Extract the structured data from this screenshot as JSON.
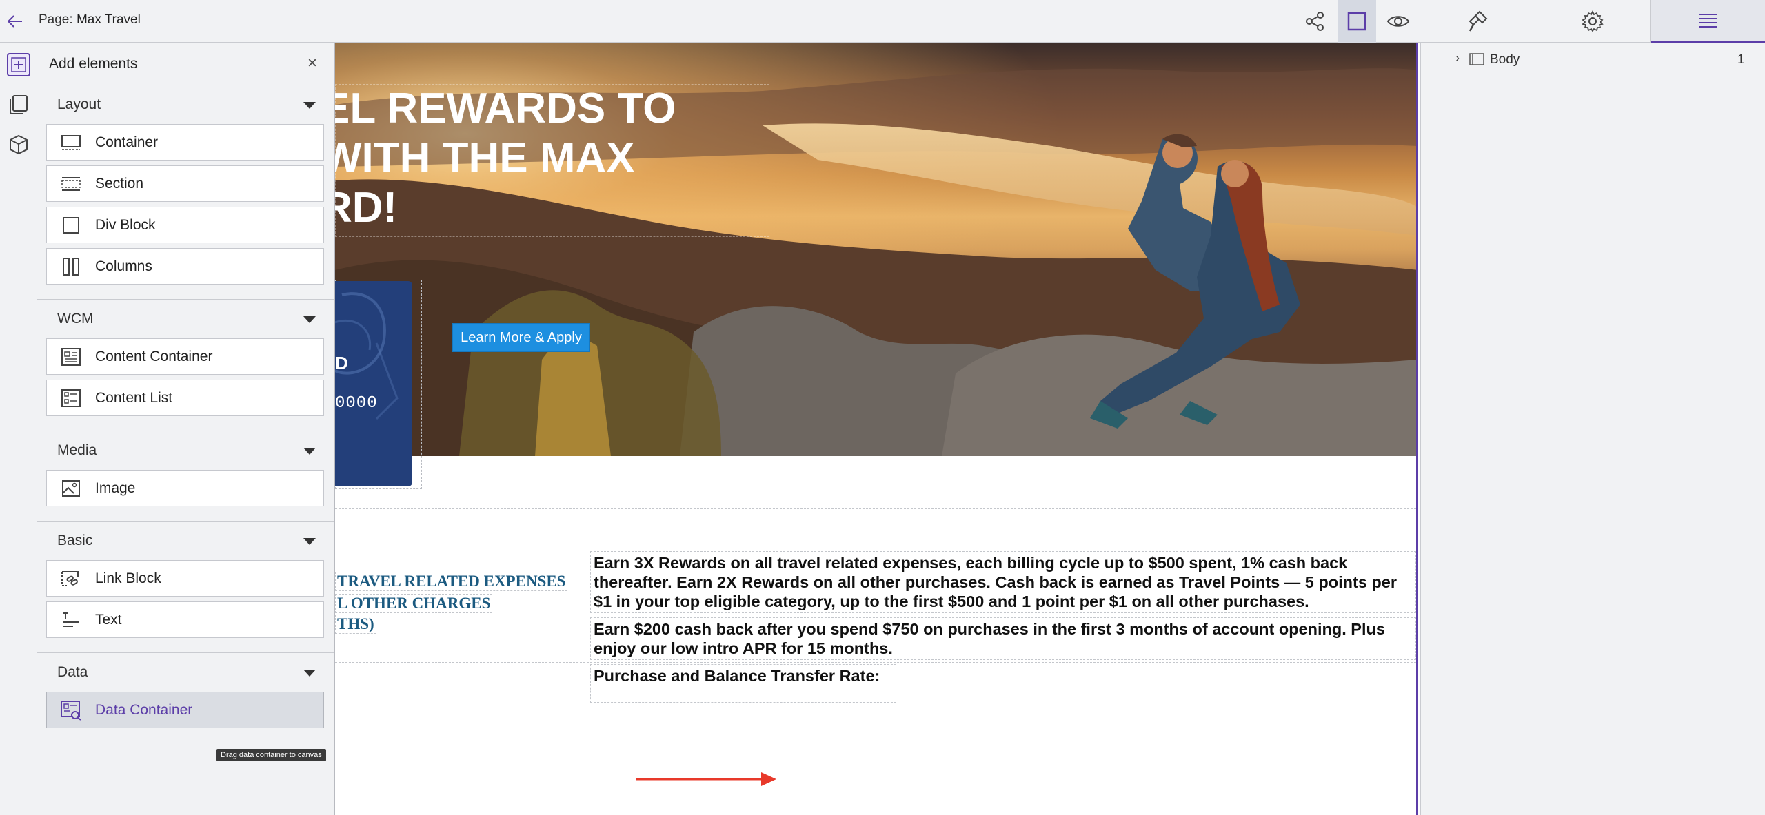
{
  "topbar": {
    "page_prefix": "Page:",
    "page_name": "Max Travel",
    "back_icon": "arrow-left-icon",
    "share_icon": "share-icon",
    "frame_icon": "square-frame-icon",
    "preview_icon": "eye-icon",
    "style_icon": "paintbrush-icon",
    "settings_icon": "gear-icon",
    "layers_icon": "hamburger-menu-icon"
  },
  "rail": {
    "add_icon": "add-element-icon",
    "pages_icon": "pages-icon",
    "assets_icon": "cube-icon"
  },
  "panel": {
    "title": "Add elements",
    "close": "×",
    "groups": [
      {
        "title": "Layout",
        "items": [
          "Container",
          "Section",
          "Div Block",
          "Columns"
        ]
      },
      {
        "title": "WCM",
        "items": [
          "Content Container",
          "Content List"
        ]
      },
      {
        "title": "Media",
        "items": [
          "Image"
        ]
      },
      {
        "title": "Basic",
        "items": [
          "Link Block",
          "Text"
        ]
      },
      {
        "title": "Data",
        "items": [
          "Data Container"
        ]
      }
    ],
    "tooltip": "Drag data container to canvas"
  },
  "canvas": {
    "hero_title_lines": [
      "EL REWARDS TO",
      "WITH THE MAX",
      "RD!"
    ],
    "card_letter": "D",
    "card_digits": "0000",
    "learn_button": "Learn More & Apply",
    "left_lines": [
      "TRAVEL RELATED EXPENSES",
      "L OTHER CHARGES",
      "THS)"
    ],
    "right_paragraphs": [
      "Earn 3X Rewards on all travel related expenses, each billing cycle up to $500 spent, 1% cash back thereafter. Earn 2X Rewards on all other purchases. Cash back is earned as Travel Points — 5 points per $1 in your top eligible category, up to the first $500 and 1 point per $1 on all other purchases.",
      "Earn $200 cash back after you spend $750 on purchases in the first 3 months of account opening. Plus enjoy our low intro APR for 15 months."
    ],
    "rate_label": "Purchase and Balance Transfer Rate:",
    "arrow_color": "#e8392a"
  },
  "layers": {
    "row_label": "Body",
    "row_count": "1"
  },
  "colors": {
    "accent": "#5c3ea8",
    "button_blue": "#1d8fe0",
    "card_navy": "#233f7a",
    "left_text": "#1b5a80"
  }
}
